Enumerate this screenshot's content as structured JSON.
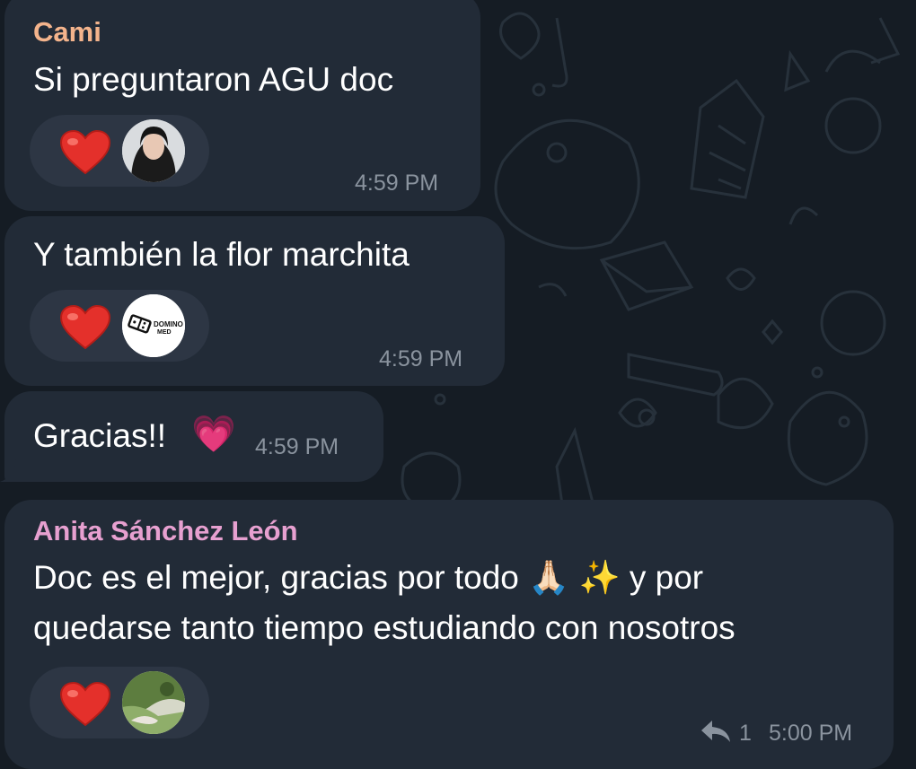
{
  "colors": {
    "background": "#151c24",
    "bubble": "#222b37",
    "reaction_pill": "#2d3644",
    "time": "#8a939e",
    "sender_cami": "#f4b48c",
    "sender_anita": "#e7a0d0"
  },
  "messages": [
    {
      "sender": "Cami",
      "text": "Si preguntaron AGU doc",
      "time": "4:59 PM",
      "reaction": {
        "emoji": "heart",
        "avatar": "user-photo-avatar"
      }
    },
    {
      "text": "Y también la flor marchita",
      "time": "4:59 PM",
      "reaction": {
        "emoji": "heart",
        "avatar": "domino-med-logo-avatar",
        "avatar_text_1": "DOMINO",
        "avatar_text_2": "MED"
      }
    },
    {
      "text": "Gracias!!",
      "emoji": "💗",
      "time": "4:59 PM"
    },
    {
      "sender": "Anita Sánchez León",
      "text_line1_a": "Doc es el mejor, gracias por todo",
      "emoji_1": "🙏🏻",
      "emoji_2": "✨",
      "text_line1_b": "y por",
      "text_line2": "quedarse tanto tiempo estudiando con nosotros",
      "time": "5:00 PM",
      "reply_count": "1",
      "reaction": {
        "emoji": "heart",
        "avatar": "landscape-photo-avatar"
      }
    }
  ]
}
